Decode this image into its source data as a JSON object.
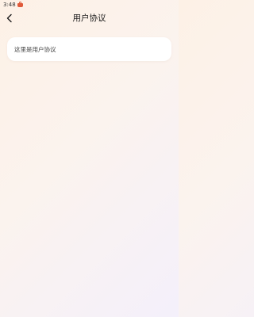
{
  "status_bar": {
    "time": "3:48",
    "app_icon": "shopping-bag-icon",
    "app_icon_color": "#e05a3a"
  },
  "nav": {
    "back_icon": "chevron-left-icon",
    "title": "用户协议"
  },
  "content": {
    "text": "这里是用户协议"
  },
  "colors": {
    "background_start": "#fdf1e6",
    "background_end": "#f4f0fb",
    "card": "#ffffff"
  }
}
